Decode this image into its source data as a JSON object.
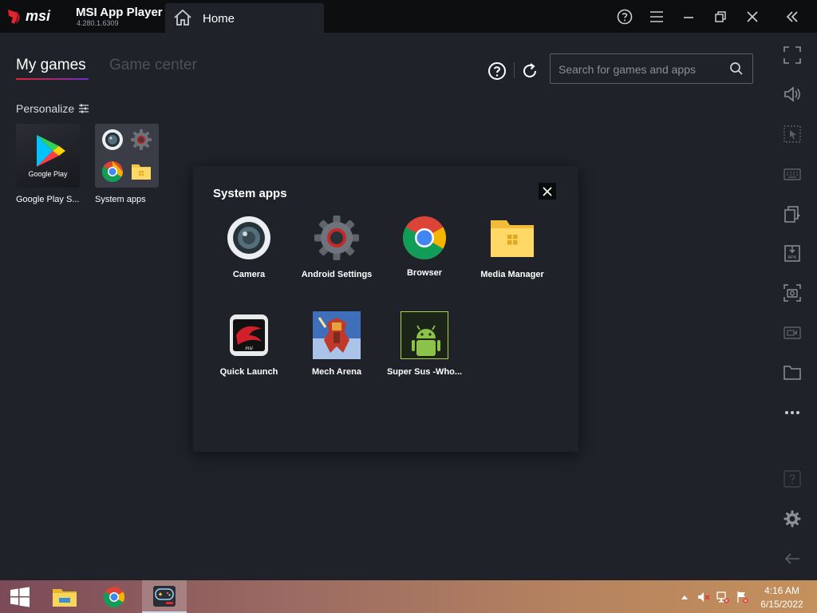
{
  "titlebar": {
    "app_name": "MSI App Player",
    "version": "4.280.1.6309",
    "home_tab": "Home",
    "logo_text": "msi"
  },
  "main": {
    "tabs": [
      {
        "label": "My games",
        "active": true
      },
      {
        "label": "Game center",
        "active": false
      }
    ],
    "search": {
      "placeholder": "Search for games and apps",
      "value": ""
    },
    "personalize_label": "Personalize",
    "tiles": [
      {
        "label": "Google Play S...",
        "icon_text": "Google Play"
      },
      {
        "label": "System apps"
      }
    ]
  },
  "popup": {
    "title": "System apps",
    "apps": [
      {
        "label": "Camera",
        "icon": "camera-icon"
      },
      {
        "label": "Android Settings",
        "icon": "gear-icon"
      },
      {
        "label": "Browser",
        "icon": "chrome-icon"
      },
      {
        "label": "Media Manager",
        "icon": "folder-icon"
      },
      {
        "label": "Quick Launch",
        "icon": "msi-dragon-icon",
        "icon_text": "msi"
      },
      {
        "label": "Mech Arena",
        "icon": "mech-arena-icon"
      },
      {
        "label": "Super Sus -Who...",
        "icon": "android-icon"
      }
    ]
  },
  "sidebar": {
    "icons": [
      "fullscreen-icon",
      "volume-icon",
      "cursor-icon",
      "keyboard-icon",
      "multi-instance-icon",
      "apk-install-icon",
      "screenshot-icon",
      "record-icon",
      "folder-icon",
      "more-icon",
      "help-icon",
      "settings-icon",
      "back-icon"
    ],
    "apk_text": "APK"
  },
  "taskbar": {
    "time": "4:16 AM",
    "date": "6/15/2022",
    "apps": [
      "windows-start-icon",
      "file-explorer-icon",
      "chrome-icon",
      "msi-app-player-icon"
    ]
  },
  "colors": {
    "background": "#1f2229",
    "titlebar": "#0d0e10",
    "accent_red": "#e0252e",
    "accent_purple": "#6b2fbf"
  }
}
